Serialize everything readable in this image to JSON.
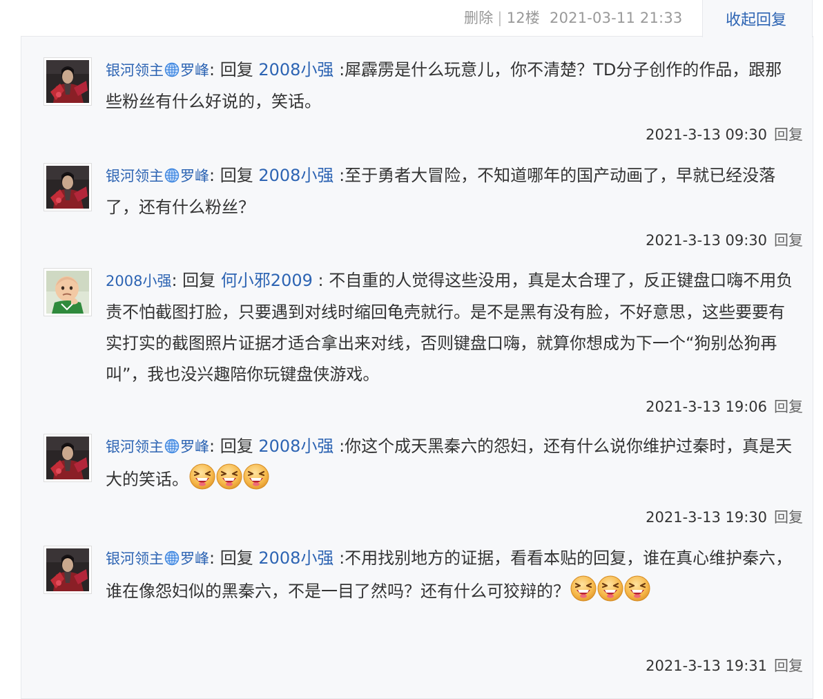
{
  "header": {
    "delete_label": "删除",
    "floor": "12楼",
    "date": "2021-03-11 21:33",
    "collapse_label": "收起回复"
  },
  "replies": [
    {
      "user": "银河领主",
      "user_suffix": "罗峰",
      "avatar": "warrior-avatar",
      "reply_word": "回复",
      "target": "2008小强",
      "text": ":犀霹雳是什么玩意儿，你不清楚？TD分子创作的作品，跟那些粉丝有什么好说的，笑话。",
      "time": "2021-3-13 09:30",
      "reply_label": "回复"
    },
    {
      "user": "银河领主",
      "user_suffix": "罗峰",
      "avatar": "warrior-avatar",
      "reply_word": "回复",
      "target": "2008小强",
      "text": ":至于勇者大冒险，不知道哪年的国产动画了，早就已经没落了，还有什么粉丝？",
      "time": "2021-3-13 09:30",
      "reply_label": "回复"
    },
    {
      "user": "2008小强",
      "user_suffix": "",
      "avatar": "baby-avatar",
      "reply_word": "回复",
      "target": "何小邪2009",
      "text": " : 不自重的人觉得这些没用，真是太合理了，反正键盘口嗨不用负责不怕截图打脸，只要遇到对线时缩回龟壳就行。是不是黑有没有脸，不好意思，这些要要有实打实的截图照片证据才适合拿出来对线，否则键盘口嗨，就算你想成为下一个“狗别怂狗再叫”，我也没兴趣陪你玩键盘侠游戏。",
      "time": "2021-3-13 19:06",
      "reply_label": "回复"
    },
    {
      "user": "银河领主",
      "user_suffix": "罗峰",
      "avatar": "warrior-avatar",
      "reply_word": "回复",
      "target": "2008小强",
      "text": ":你这个成天黑秦六的怨妇，还有什么说你维护过秦时，真是天大的笑话。",
      "time": "2021-3-13 19:30",
      "reply_label": "回复"
    },
    {
      "user": "银河领主",
      "user_suffix": "罗峰",
      "avatar": "warrior-avatar",
      "reply_word": "回复",
      "target": "2008小强",
      "text": ":不用找别地方的证据，看看本贴的回复，谁在真心维护秦六，谁在像怨妇似的黑秦六，不是一目了然吗？还有什么可狡辩的？",
      "time": "2021-3-13 19:31",
      "reply_label": "回复"
    }
  ]
}
